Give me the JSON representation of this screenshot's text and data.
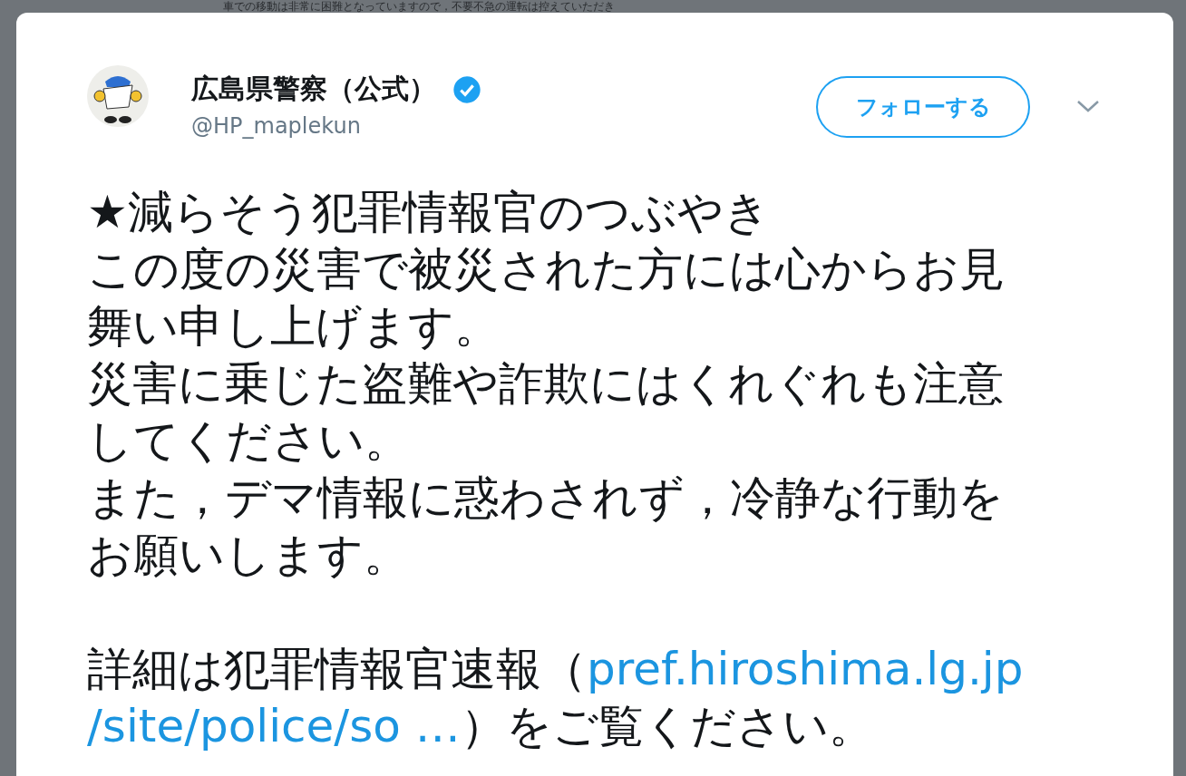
{
  "background_text": "車での移動は非常に困難となっていますので，不要不急の運転は控えていただき",
  "tweet": {
    "author": {
      "name": "広島県警察（公式）",
      "verified": true,
      "handle": "@HP_maplekun"
    },
    "follow_button": "フォローする",
    "lines": [
      [
        {
          "kind": "text",
          "text": "★減らそう犯罪情報官のつぶやき"
        }
      ],
      [
        {
          "kind": "text",
          "text": "この度の災害で被災された方には心からお見"
        }
      ],
      [
        {
          "kind": "text",
          "text": "舞い申し上げます。"
        }
      ],
      [
        {
          "kind": "text",
          "text": "災害に乗じた盗難や詐欺にはくれぐれも注意"
        }
      ],
      [
        {
          "kind": "text",
          "text": "してください。"
        }
      ],
      [
        {
          "kind": "text",
          "text": "また，デマ情報に惑わされず，冷静な行動を"
        }
      ],
      [
        {
          "kind": "text",
          "text": "お願いします。"
        }
      ],
      [
        {
          "kind": "gap"
        }
      ],
      [
        {
          "kind": "text",
          "text": "詳細は犯罪情報官速報（"
        },
        {
          "kind": "link",
          "text": "pref.hiroshima.lg.jp"
        }
      ],
      [
        {
          "kind": "link",
          "text": "/site/police/so …"
        },
        {
          "kind": "text",
          "text": "）をご覧ください。"
        }
      ]
    ]
  }
}
